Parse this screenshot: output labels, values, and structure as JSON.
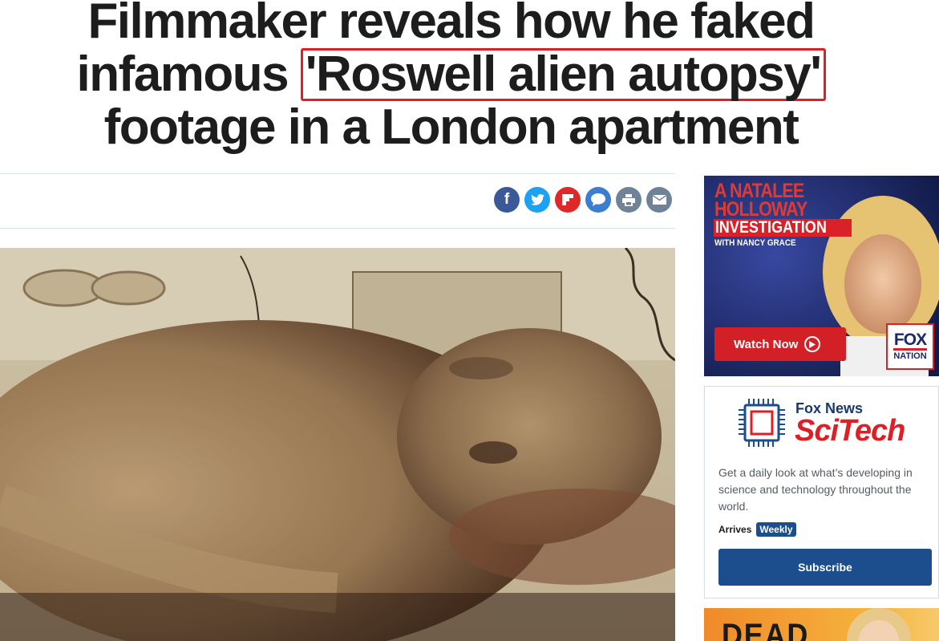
{
  "headline": {
    "line1": "Filmmaker reveals how he faked",
    "line2_prefix": "infamous",
    "line2_highlight": "'Roswell alien autopsy'",
    "line3": "footage in a London apartment"
  },
  "share": {
    "icons": [
      {
        "name": "facebook",
        "glyph": "f",
        "color": "#3b5998"
      },
      {
        "name": "twitter",
        "color": "#1da1f2"
      },
      {
        "name": "flipboard",
        "color": "#e12828"
      },
      {
        "name": "comments",
        "color": "#3c7dd0"
      },
      {
        "name": "print",
        "color": "#6f8398"
      },
      {
        "name": "email",
        "color": "#6f8398"
      }
    ]
  },
  "hero": {
    "alt": "Roswell alien autopsy still"
  },
  "ad1": {
    "title_line1": "A NATALEE",
    "title_line2": "HOLLOWAY",
    "title_line3": "INVESTIGATION",
    "subtitle": "WITH NANCY GRACE",
    "cta": "Watch Now",
    "logo_top": "FOX",
    "logo_bottom": "NATION",
    "accent": "#d92127",
    "bg": "#1b2a66"
  },
  "newsletter": {
    "brand_top": "Fox News",
    "brand_main": "SciTech",
    "description": "Get a daily look at what’s developing in science and technology throughout the world.",
    "arrives_label": "Arrives",
    "frequency": "Weekly",
    "subscribe_label": "Subscribe",
    "brand_color": "#1c4d8c",
    "accent": "#e01e26"
  },
  "ad2": {
    "text": "DEAD"
  }
}
